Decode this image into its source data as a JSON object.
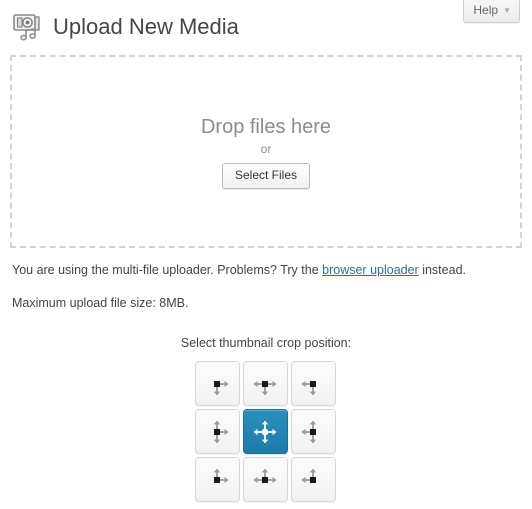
{
  "header": {
    "title": "Upload New Media",
    "icon": "media-camera-icon",
    "help_label": "Help",
    "help_caret": "▼"
  },
  "dropzone": {
    "drop_text": "Drop files here",
    "or_text": "or",
    "select_files_label": "Select Files"
  },
  "info": {
    "uploader_notice_before": "You are using the multi-file uploader. Problems? Try the ",
    "uploader_link": "browser uploader",
    "uploader_notice_after": " instead.",
    "max_size": "Maximum upload file size: 8MB."
  },
  "crop": {
    "label": "Select thumbnail crop position:",
    "selected": "center-center",
    "selected_color": "#2a8fbf",
    "cells": [
      {
        "name": "left-top",
        "arrows": [
          "right",
          "down"
        ],
        "selected": false
      },
      {
        "name": "center-top",
        "arrows": [
          "left",
          "right",
          "down"
        ],
        "selected": false
      },
      {
        "name": "right-top",
        "arrows": [
          "left",
          "down"
        ],
        "selected": false
      },
      {
        "name": "left-center",
        "arrows": [
          "up",
          "down",
          "right"
        ],
        "selected": false
      },
      {
        "name": "center-center",
        "arrows": [
          "up",
          "down",
          "left",
          "right"
        ],
        "selected": true
      },
      {
        "name": "right-center",
        "arrows": [
          "up",
          "down",
          "left"
        ],
        "selected": false
      },
      {
        "name": "left-bottom",
        "arrows": [
          "up",
          "right"
        ],
        "selected": false
      },
      {
        "name": "center-bottom",
        "arrows": [
          "up",
          "left",
          "right"
        ],
        "selected": false
      },
      {
        "name": "right-bottom",
        "arrows": [
          "up",
          "left"
        ],
        "selected": false
      }
    ]
  }
}
